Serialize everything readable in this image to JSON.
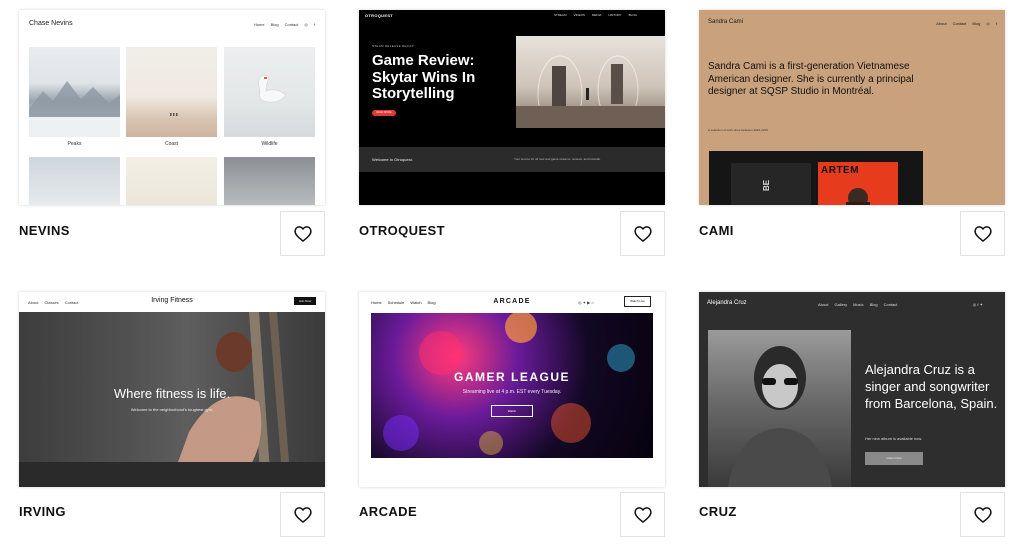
{
  "templates": [
    {
      "title": "NEVINS",
      "preview": {
        "logo": "Chase Nevins",
        "nav": [
          "Home",
          "Blog",
          "Contact"
        ],
        "icons": [
          "instagram-icon",
          "facebook-icon"
        ],
        "tiles": [
          "Peaks",
          "Coast",
          "Wildlife"
        ]
      }
    },
    {
      "title": "OTROQUEST",
      "preview": {
        "logo": "OTROQUEST",
        "nav": [
          "STREAM",
          "VIDEOS",
          "MEDIA",
          "HISTORY",
          "BLOG"
        ],
        "kicker": "STEAM RELEASE RECAP",
        "headline": "Game Review: Skytar Wins In Storytelling",
        "cta": "READ MORE",
        "band_left": "Welcome to Otroquest.",
        "band_right": "Your source for all new and game streams, reviews, and tutorials."
      }
    },
    {
      "title": "CAMI",
      "preview": {
        "logo": "Sandra Cami",
        "nav": [
          "About",
          "Contact",
          "Blog"
        ],
        "bio": "Sandra Cami is a first-generation Vietnamese American designer. She is currently a principal designer at SQSP Studio in Montréal.",
        "note": "A selection of work done between 2012-2019",
        "poster_text": "ARTEM"
      }
    },
    {
      "title": "IRVING",
      "preview": {
        "logo": "Irving Fitness",
        "nav": [
          "About",
          "Classes",
          "Contact"
        ],
        "button": "Join Now",
        "hero_title": "Where fitness is life.",
        "hero_subtitle": "Welcome to the neighborhood's toughest gym."
      }
    },
    {
      "title": "ARCADE",
      "preview": {
        "logo": "ARCADE",
        "nav": [
          "Home",
          "Schedule",
          "Watch",
          "Blog"
        ],
        "watch_button": "Watch Live",
        "hero_title": "GAMER LEAGUE",
        "hero_subtitle": "Streaming live at 4 p.m. EST every Tuesday.",
        "hero_button": "Watch"
      }
    },
    {
      "title": "CRUZ",
      "preview": {
        "logo": "Alejandra Cruz",
        "nav": [
          "About",
          "Gallery",
          "Music",
          "Blog",
          "Contact"
        ],
        "bio": "Alejandra Cruz is a singer and songwriter from Barcelona, Spain.",
        "subtitle": "Her new album is available now.",
        "button": "Listen Now"
      }
    }
  ],
  "colors": {
    "cami_bg": "#c9a27d",
    "cami_accent": "#e63b1d",
    "otroquest_cta": "#e53935"
  },
  "icons": {
    "favorite": "heart-icon"
  }
}
